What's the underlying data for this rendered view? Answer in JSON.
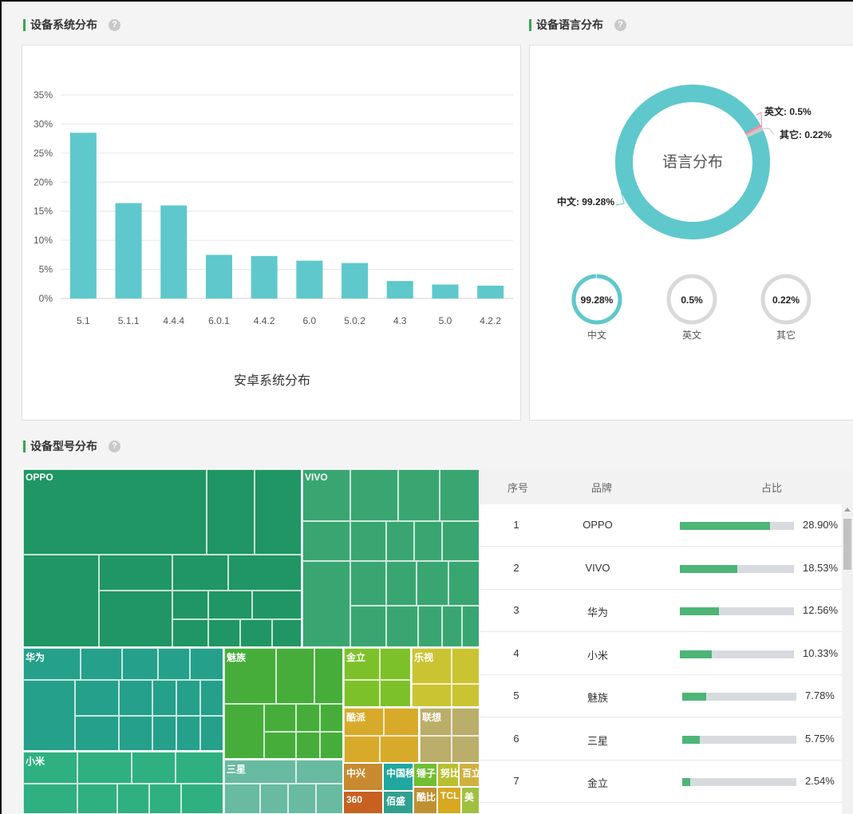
{
  "sections": {
    "os": "设备系统分布",
    "language": "设备语言分布",
    "model": "设备型号分布",
    "help": "?"
  },
  "chart_data": [
    {
      "type": "bar",
      "title": "安卓系统分布",
      "categories": [
        "5.1",
        "5.1.1",
        "4.4.4",
        "6.0.1",
        "4.4.2",
        "6.0",
        "5.0.2",
        "4.3",
        "5.0",
        "4.2.2"
      ],
      "values": [
        28.5,
        16.4,
        16.0,
        7.5,
        7.3,
        6.5,
        6.1,
        3.0,
        2.4,
        2.2
      ],
      "yticks": [
        "0%",
        "5%",
        "10%",
        "15%",
        "20%",
        "25%",
        "30%",
        "35%"
      ],
      "ylim": [
        0,
        35
      ],
      "grid": true,
      "color": "#5ec8cc"
    },
    {
      "type": "pie",
      "title": "语言分布",
      "labels": [
        "中文",
        "英文",
        "其它"
      ],
      "values": [
        99.28,
        0.5,
        0.22
      ],
      "slice_labels": [
        "中文: 99.28%",
        "英文: 0.5%",
        "其它: 0.22%"
      ],
      "colors": [
        "#5ec8cc",
        "#f08ca0",
        "#c8c8c8"
      ],
      "mini_gauges": [
        {
          "label": "中文",
          "value_text": "99.28%",
          "value": 99.28
        },
        {
          "label": "英文",
          "value_text": "0.5%",
          "value": 0.5
        },
        {
          "label": "其它",
          "value_text": "0.22%",
          "value": 0.22
        }
      ]
    },
    {
      "type": "treemap",
      "labels": [
        "OPPO",
        "VIVO",
        "华为",
        "魅族",
        "金立",
        "乐视",
        "酷派",
        "联想",
        "小米",
        "三星",
        "中兴",
        "中国移",
        "锤子",
        "努比",
        "百立",
        "360",
        "佰盛",
        "酷比",
        "TCL",
        "美"
      ],
      "colors": {
        "OPPO": "#1f9663",
        "VIVO": "#39a672",
        "华为": "#25a08a",
        "魅族": "#46ad3a",
        "金立": "#7dc12a",
        "乐视": "#cac433",
        "酷派": "#d8aa2a",
        "联想": "#baae6a",
        "小米": "#2fb080",
        "三星": "#68baa0",
        "中兴": "#c88a30",
        "中国移": "#1fa7a0",
        "锤子": "#6fbf30",
        "努比": "#b8c030",
        "百立": "#d0b040",
        "360": "#c86020",
        "佰盛": "#30a090",
        "酷比": "#c09030",
        "TCL": "#d8a820",
        "美": "#a0c040"
      }
    },
    {
      "type": "table",
      "columns": [
        "序号",
        "品牌",
        "占比"
      ],
      "rows": [
        {
          "index": "1",
          "brand": "OPPO",
          "percent_text": "28.90%",
          "percent": 28.9
        },
        {
          "index": "2",
          "brand": "VIVO",
          "percent_text": "18.53%",
          "percent": 18.53
        },
        {
          "index": "3",
          "brand": "华为",
          "percent_text": "12.56%",
          "percent": 12.56
        },
        {
          "index": "4",
          "brand": "小米",
          "percent_text": "10.33%",
          "percent": 10.33
        },
        {
          "index": "5",
          "brand": "魅族",
          "percent_text": "7.78%",
          "percent": 7.78
        },
        {
          "index": "6",
          "brand": "三星",
          "percent_text": "5.75%",
          "percent": 5.75
        },
        {
          "index": "7",
          "brand": "金立",
          "percent_text": "2.54%",
          "percent": 2.54
        }
      ]
    }
  ]
}
